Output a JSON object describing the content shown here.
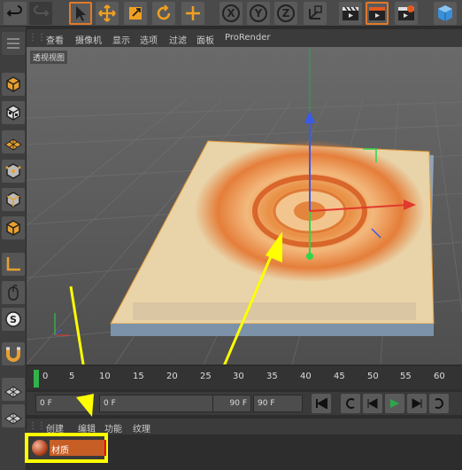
{
  "viewport": {
    "menu": [
      "查看",
      "摄像机",
      "显示",
      "选项",
      "过滤",
      "面板",
      "ProRender"
    ],
    "label": "透视视图"
  },
  "timeline": {
    "ticks": [
      "0",
      "5",
      "10",
      "15",
      "20",
      "25",
      "30",
      "35",
      "40",
      "45",
      "50",
      "55",
      "60"
    ]
  },
  "transport": {
    "current_frame": "0 F",
    "start_frame": "0 F",
    "end_frame": "90 F",
    "max_frame": "90 F"
  },
  "material_manager": {
    "menu": [
      "创建",
      "编辑",
      "功能",
      "纹理"
    ],
    "material_name": "材质"
  },
  "colors": {
    "accent_orange": "#c65e26",
    "highlight_yellow": "#ffff00",
    "timeline_marker": "#2fb34a"
  }
}
